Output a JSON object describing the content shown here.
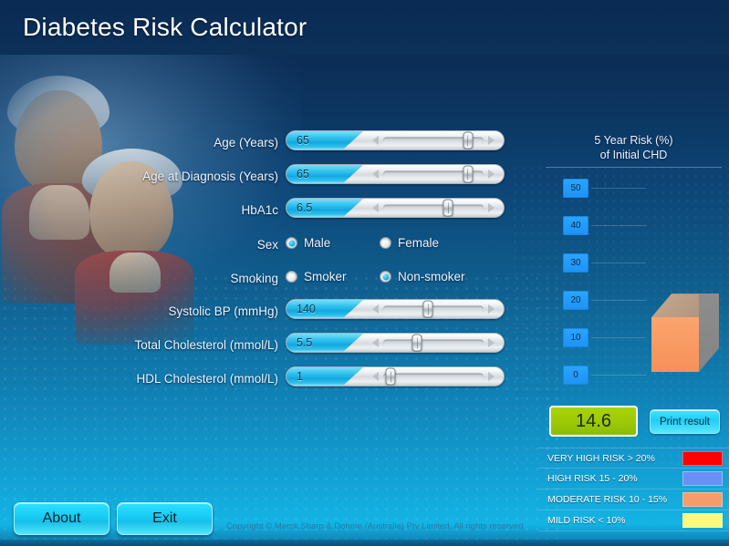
{
  "header": {
    "title": "Diabetes Risk Calculator"
  },
  "form": {
    "sliders": [
      {
        "label": "Age (Years)",
        "value": "65",
        "thumb_pct": 76
      },
      {
        "label": "Age at Diagnosis (Years)",
        "value": "65",
        "thumb_pct": 76
      },
      {
        "label": "HbA1c",
        "value": "6.5",
        "thumb_pct": 61
      },
      {
        "label": "Systolic BP (mmHg)",
        "value": "140",
        "thumb_pct": 46
      },
      {
        "label": "Total Cholesterol (mmol/L)",
        "value": "5.5",
        "thumb_pct": 38
      },
      {
        "label": "HDL Cholesterol (mmol/L)",
        "value": "1",
        "thumb_pct": 18
      }
    ],
    "sex": {
      "label": "Sex",
      "options": [
        {
          "label": "Male",
          "selected": true
        },
        {
          "label": "Female",
          "selected": false
        }
      ]
    },
    "smoking": {
      "label": "Smoking",
      "options": [
        {
          "label": "Smoker",
          "selected": false
        },
        {
          "label": "Non-smoker",
          "selected": true
        }
      ]
    }
  },
  "chart_data": {
    "type": "bar",
    "title": "5 Year Risk (%)\nof Initial CHD",
    "title_line1": "5 Year Risk (%)",
    "title_line2": "of Initial CHD",
    "categories": [
      "5 Year Risk"
    ],
    "values": [
      14.6
    ],
    "tick_labels": [
      "50",
      "40",
      "30",
      "20",
      "10",
      "0"
    ],
    "ylim": [
      0,
      50
    ],
    "ylabel": "",
    "xlabel": "",
    "grid": true,
    "legend_position": "bottom",
    "bar_color": "#f99a63",
    "bar_side_color": "#8d8d8d",
    "bar_top_color": "#b79b84"
  },
  "result": {
    "value": "14.6",
    "print_label": "Print result",
    "value_bg": "#9cc806"
  },
  "legend": {
    "rows": [
      {
        "label": "VERY HIGH RISK > 20%",
        "color": "#ff0000"
      },
      {
        "label": "HIGH RISK 15 - 20%",
        "color": "#6b8ff5"
      },
      {
        "label": "MODERATE RISK 10 - 15%",
        "color": "#f89b6c"
      },
      {
        "label": "MILD RISK < 10%",
        "color": "#fafa7d"
      }
    ]
  },
  "footer": {
    "about_label": "About",
    "exit_label": "Exit",
    "copyright": "Copyright © Merck Sharp & Dohme (Australia) Pty Limited. All rights reserved"
  }
}
